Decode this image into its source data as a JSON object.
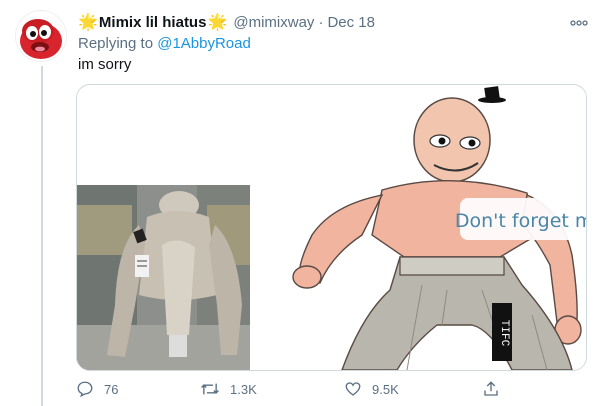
{
  "tweet": {
    "display_name": "Mimix lil hiatus",
    "name_emoji": "🌟",
    "handle": "@mimixway",
    "separator": "·",
    "date": "Dec 18",
    "replying_prefix": "Replying to",
    "replying_to": "@1AbbyRoad",
    "text": "im sorry",
    "more_icon": "more-dots-icon"
  },
  "media": {
    "drawing_caption": "Don't forget me",
    "censor_text": "TIFC"
  },
  "actions": {
    "reply_count": "76",
    "retweet_count": "1.3K",
    "like_count": "9.5K"
  },
  "colors": {
    "accent": "#1b95e0",
    "muted": "#5b7083",
    "text": "#0f1419",
    "star": "#f4a81a"
  }
}
